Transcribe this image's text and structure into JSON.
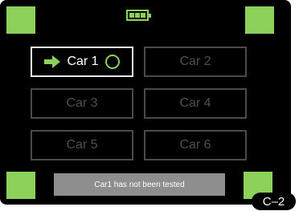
{
  "battery": {
    "icon": "battery-icon",
    "level": 0.9
  },
  "cars": [
    {
      "label": "Car 1",
      "selected": true
    },
    {
      "label": "Car 2",
      "selected": false
    },
    {
      "label": "Car 3",
      "selected": false
    },
    {
      "label": "Car 4",
      "selected": false
    },
    {
      "label": "Car 5",
      "selected": false
    },
    {
      "label": "Car 6",
      "selected": false
    }
  ],
  "status": {
    "message": "Car1 has not been tested"
  },
  "figure_label": "C–2",
  "colors": {
    "accent": "#8dd05a",
    "background": "#000000",
    "selected_border": "#e8e8e8",
    "inactive_text": "#4f4f4f",
    "status_bar": "#8e8e8e"
  },
  "icons": {
    "selection_arrow": "arrow-right-icon",
    "status_indicator": "circle-icon"
  }
}
